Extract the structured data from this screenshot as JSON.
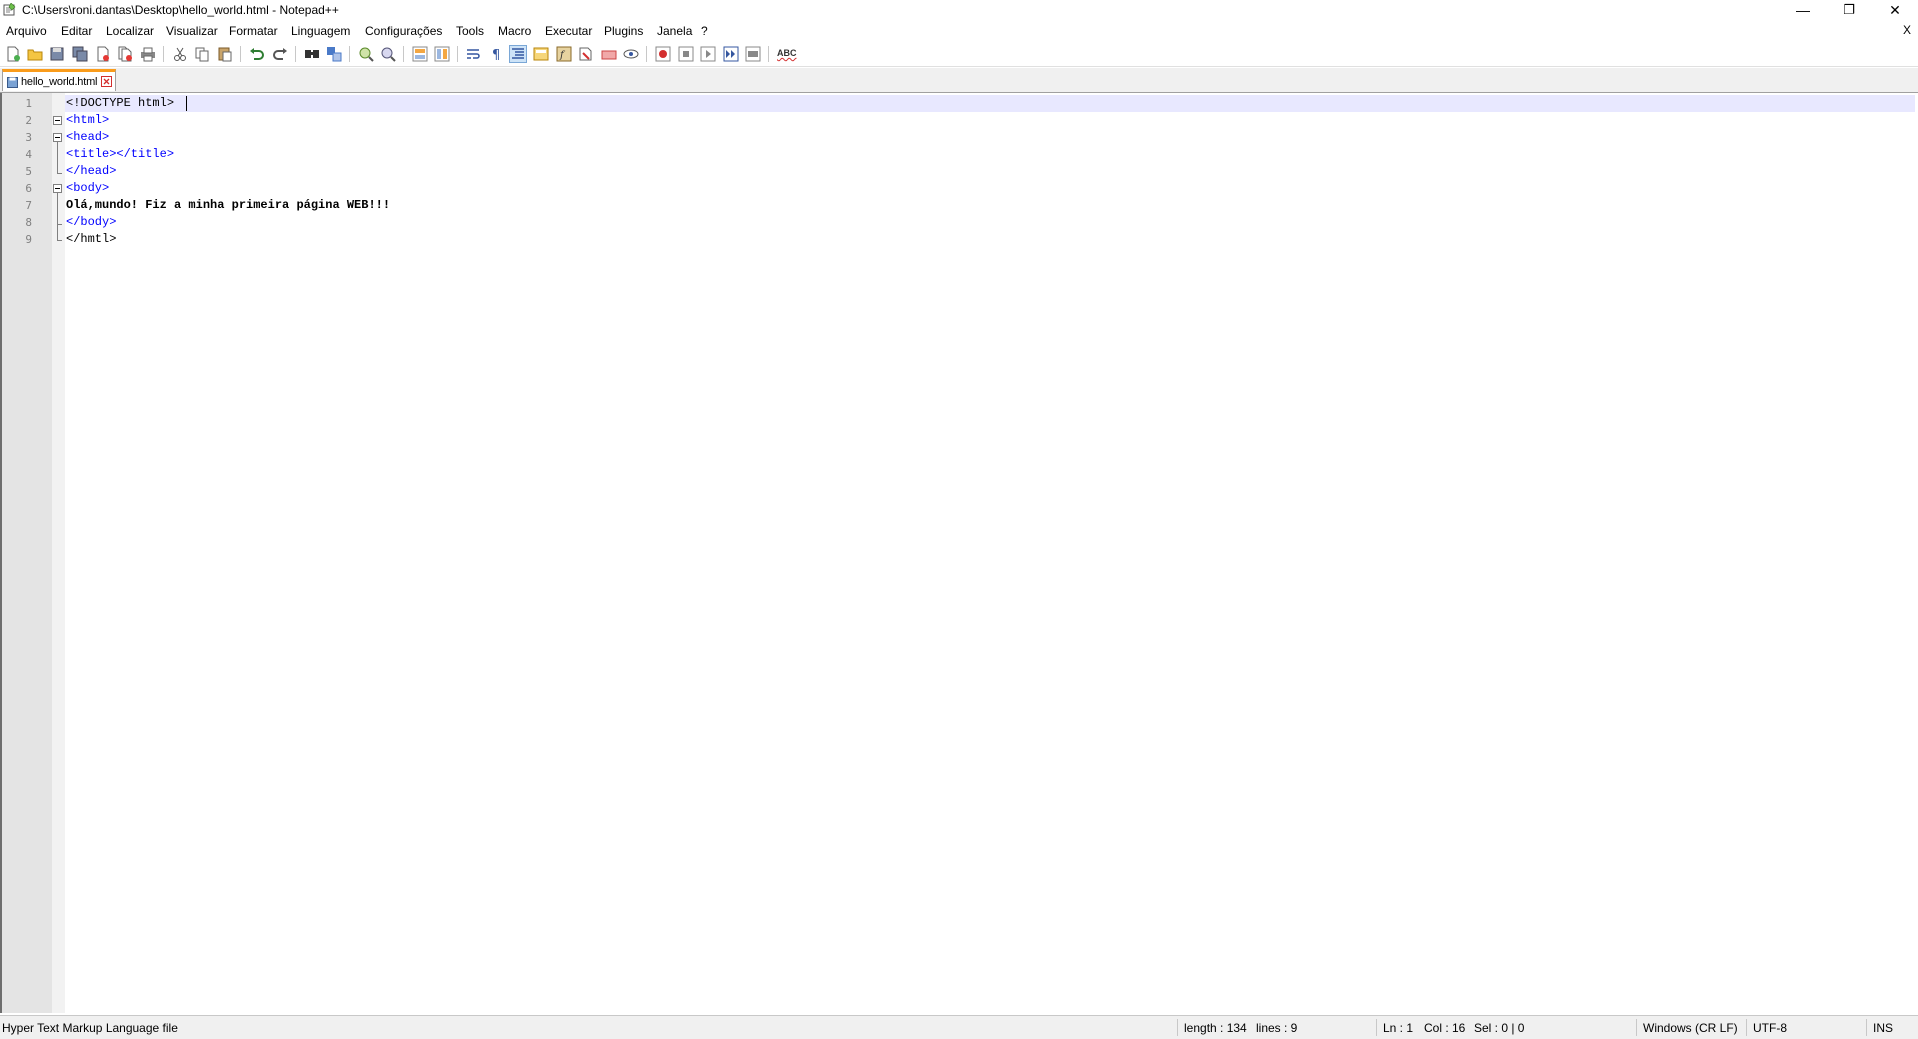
{
  "window": {
    "title": "C:\\Users\\roni.dantas\\Desktop\\hello_world.html - Notepad++",
    "minimize": "—",
    "restore": "❐",
    "close": "✕"
  },
  "menu": {
    "items": [
      "Arquivo",
      "Editar",
      "Localizar",
      "Visualizar",
      "Formatar",
      "Linguagem",
      "Configurações",
      "Tools",
      "Macro",
      "Executar",
      "Plugins",
      "Janela",
      "?"
    ],
    "close_doc": "X"
  },
  "toolbar": {
    "buttons": [
      "new-file-icon",
      "open-file-icon",
      "save-icon",
      "save-all-icon",
      "close-icon",
      "close-all-icon",
      "print-icon",
      "cut-icon",
      "copy-icon",
      "paste-icon",
      "undo-icon",
      "redo-icon",
      "find-icon",
      "replace-icon",
      "zoom-in-icon",
      "zoom-out-icon",
      "sync-vertical-icon",
      "sync-horizontal-icon",
      "word-wrap-icon",
      "show-all-chars-icon",
      "indent-guide-icon",
      "doc-map-icon",
      "function-list-icon",
      "folder-as-workspace-icon",
      "monitoring-icon",
      "record-macro-icon",
      "stop-record-icon",
      "play-macro-icon",
      "run-macro-multiple-icon",
      "save-macro-icon",
      "spellcheck-icon"
    ],
    "spellcheck_label": "ABC"
  },
  "tab": {
    "label": "hello_world.html"
  },
  "editor": {
    "line_numbers": [
      "1",
      "2",
      "3",
      "4",
      "5",
      "6",
      "7",
      "8",
      "9"
    ],
    "lines": [
      "<!DOCTYPE html>",
      "<html>",
      "<head>",
      "<title></title>",
      "</head>",
      "<body>",
      "Olá,mundo! Fiz a minha primeira página WEB!!!",
      "</body>",
      "</hmtl>"
    ]
  },
  "status": {
    "file_type": "Hyper Text Markup Language file",
    "length": "length : 134",
    "lines": "lines : 9",
    "ln": "Ln : 1",
    "col": "Col : 16",
    "sel": "Sel : 0 | 0",
    "eol": "Windows (CR LF)",
    "encoding": "UTF-8",
    "mode": "INS"
  },
  "colors": {
    "tag": "#0000ff",
    "caret_line": "#e8e8ff",
    "active_tab_accent": "#fa9c1b",
    "gutter": "#e4e4e4"
  }
}
